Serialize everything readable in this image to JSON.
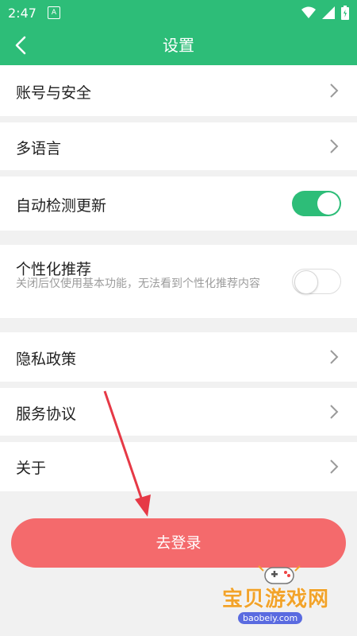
{
  "status_bar": {
    "time": "2:47",
    "notification_glyph": "A"
  },
  "header": {
    "title": "设置"
  },
  "settings": {
    "account_security": "账号与安全",
    "multi_language": "多语言",
    "auto_update": {
      "label": "自动检测更新",
      "enabled": true
    },
    "personalized": {
      "label": "个性化推荐",
      "description": "关闭后仅使用基本功能，无法看到个性化推荐内容",
      "enabled": false
    },
    "privacy_policy": "隐私政策",
    "service_agreement": "服务协议",
    "about": "关于"
  },
  "login_button": "去登录",
  "watermark": {
    "brand": "宝贝游戏网",
    "url": "baobeiy.com"
  },
  "colors": {
    "accent": "#2dbd78",
    "login": "#f46a6c",
    "arrow": "#e63946"
  }
}
